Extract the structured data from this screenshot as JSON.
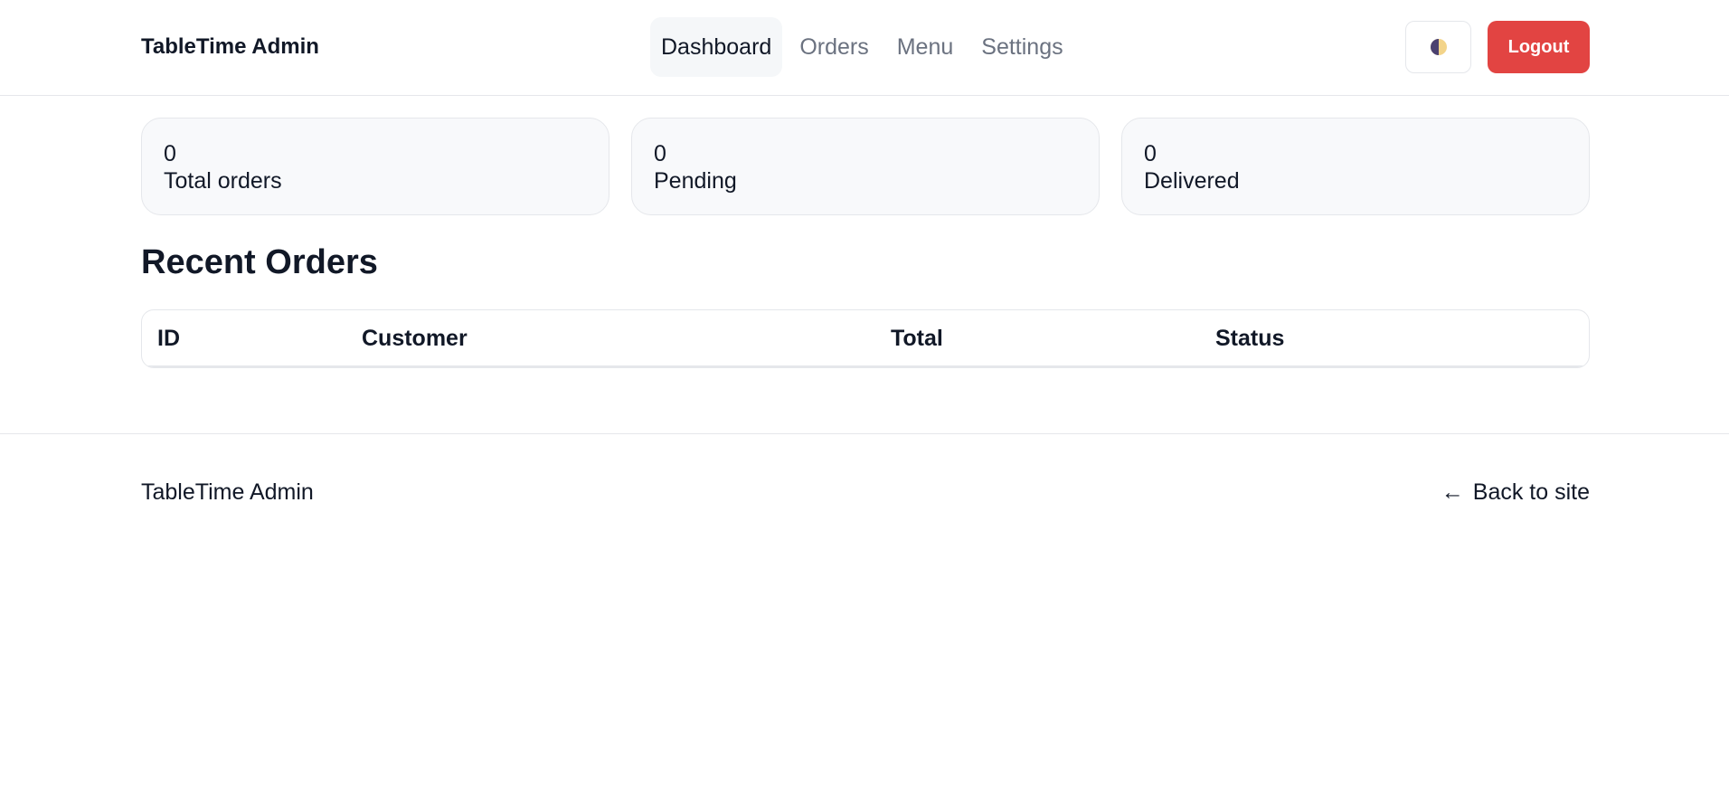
{
  "header": {
    "brand": "TableTime Admin",
    "nav": [
      {
        "label": "Dashboard",
        "active": true
      },
      {
        "label": "Orders",
        "active": false
      },
      {
        "label": "Menu",
        "active": false
      },
      {
        "label": "Settings",
        "active": false
      }
    ],
    "theme_icon": "half-circle-theme-icon",
    "logout_label": "Logout"
  },
  "stats": [
    {
      "value": "0",
      "label": "Total orders"
    },
    {
      "value": "0",
      "label": "Pending"
    },
    {
      "value": "0",
      "label": "Delivered"
    }
  ],
  "recent_orders": {
    "title": "Recent Orders",
    "columns": [
      "ID",
      "Customer",
      "Total",
      "Status"
    ]
  },
  "footer": {
    "brand": "TableTime Admin",
    "back_arrow": "←",
    "back_label": "Back to site"
  },
  "colors": {
    "logout_bg": "#e24442",
    "active_nav_bg": "#f5f7f9",
    "card_bg": "#f8f9fb",
    "border": "#e5e7eb",
    "muted_text": "#6b7280"
  }
}
